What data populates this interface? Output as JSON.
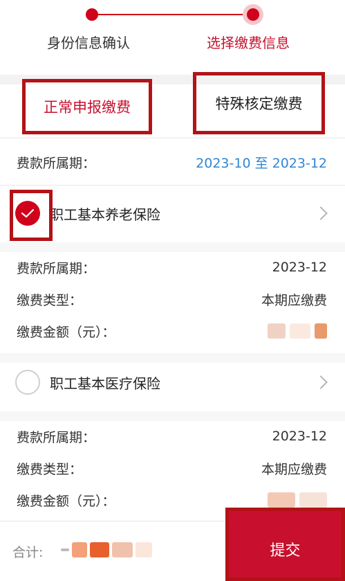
{
  "steps": {
    "step1": "身份信息确认",
    "step2": "选择缴费信息"
  },
  "tabs": {
    "normal": "正常申报缴费",
    "special": "特殊核定缴费"
  },
  "period_summary": {
    "label": "费款所属期：",
    "value": "2023-10 至 2023-12"
  },
  "items": [
    {
      "name": "职工基本养老保险",
      "checked": true,
      "period_label": "费款所属期：",
      "period_value": "2023-12",
      "type_label": "缴费类型：",
      "type_value": "本期应缴费",
      "amount_label": "缴费金额（元）："
    },
    {
      "name": "职工基本医疗保险",
      "checked": false,
      "period_label": "费款所属期：",
      "period_value": "2023-12",
      "type_label": "缴费类型：",
      "type_value": "本期应缴费",
      "amount_label": "缴费金额（元）："
    }
  ],
  "footer": {
    "total_label": "合计:",
    "submit_label": "提交"
  },
  "colors": {
    "accent": "#c8102e",
    "link_blue": "#2f86d4",
    "annotation_red": "#b31217"
  },
  "icons": {
    "check": "check-icon",
    "chevron": "chevron-right-icon"
  }
}
